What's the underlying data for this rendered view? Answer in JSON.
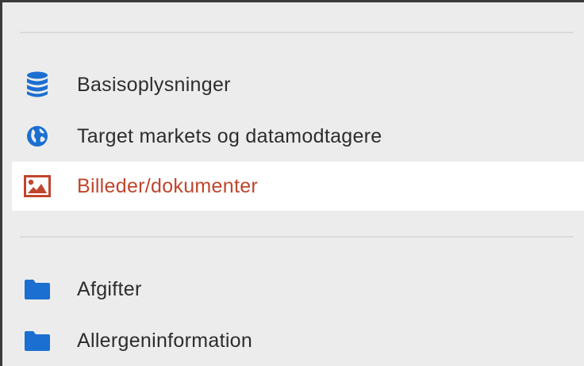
{
  "nav": {
    "items": [
      {
        "label": "Basisoplysninger",
        "icon": "database-icon"
      },
      {
        "label": "Target markets og datamodtagere",
        "icon": "globe-icon"
      },
      {
        "label": "Billeder/dokumenter",
        "icon": "image-icon",
        "active": true
      },
      {
        "label": "Afgifter",
        "icon": "folder-icon"
      },
      {
        "label": "Allergeninformation",
        "icon": "folder-icon"
      }
    ]
  },
  "colors": {
    "icon_blue": "#1b6fd1",
    "active_text": "#c0452d",
    "panel_bg": "#ececec",
    "active_bg": "#ffffff",
    "text": "#2d2d2d"
  }
}
